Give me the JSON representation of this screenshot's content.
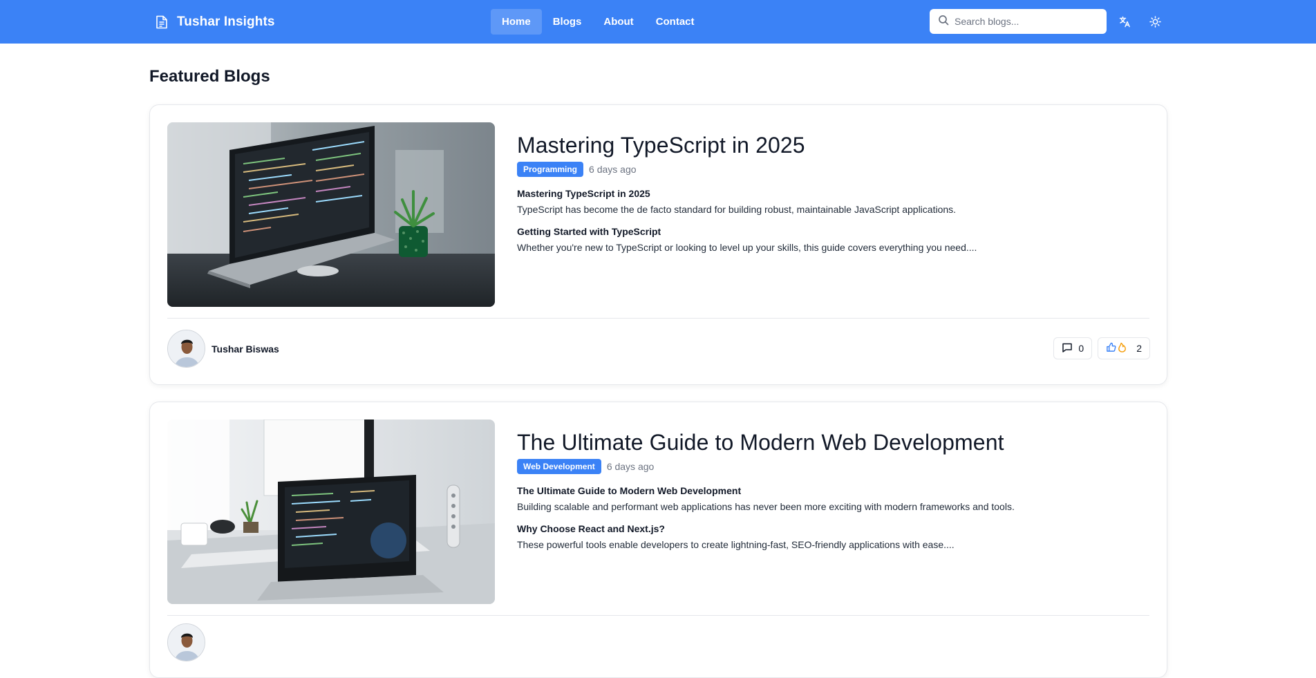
{
  "header": {
    "brand": "Tushar Insights",
    "nav": [
      {
        "label": "Home",
        "active": true
      },
      {
        "label": "Blogs"
      },
      {
        "label": "About"
      },
      {
        "label": "Contact"
      }
    ],
    "search_placeholder": "Search blogs...",
    "accent_color": "#3b82f6"
  },
  "main": {
    "section_title": "Featured Blogs",
    "posts": [
      {
        "title": "Mastering TypeScript in 2025",
        "category": "Programming",
        "date": "6 days ago",
        "heading1": "Mastering TypeScript in 2025",
        "text1": "TypeScript has become the de facto standard for building robust, maintainable JavaScript applications.",
        "heading2": "Getting Started with TypeScript",
        "text2": "Whether you're new to TypeScript or looking to level up your skills, this guide covers everything you need....",
        "author": "Tushar Biswas",
        "comments": "0",
        "reactions": "2"
      },
      {
        "title": "The Ultimate Guide to Modern Web Development",
        "category": "Web Development",
        "date": "6 days ago",
        "heading1": "The Ultimate Guide to Modern Web Development",
        "text1": "Building scalable and performant web applications has never been more exciting with modern frameworks and tools.",
        "heading2": "Why Choose React and Next.js?",
        "text2": "These powerful tools enable developers to create lightning-fast, SEO-friendly applications with ease...."
      }
    ]
  },
  "icons": {
    "brand": "document-icon",
    "search": "search-icon",
    "translate": "translate-icon",
    "theme": "sun-icon",
    "comment": "comment-icon",
    "like": "thumbs-up-icon",
    "fire": "fire-icon"
  }
}
